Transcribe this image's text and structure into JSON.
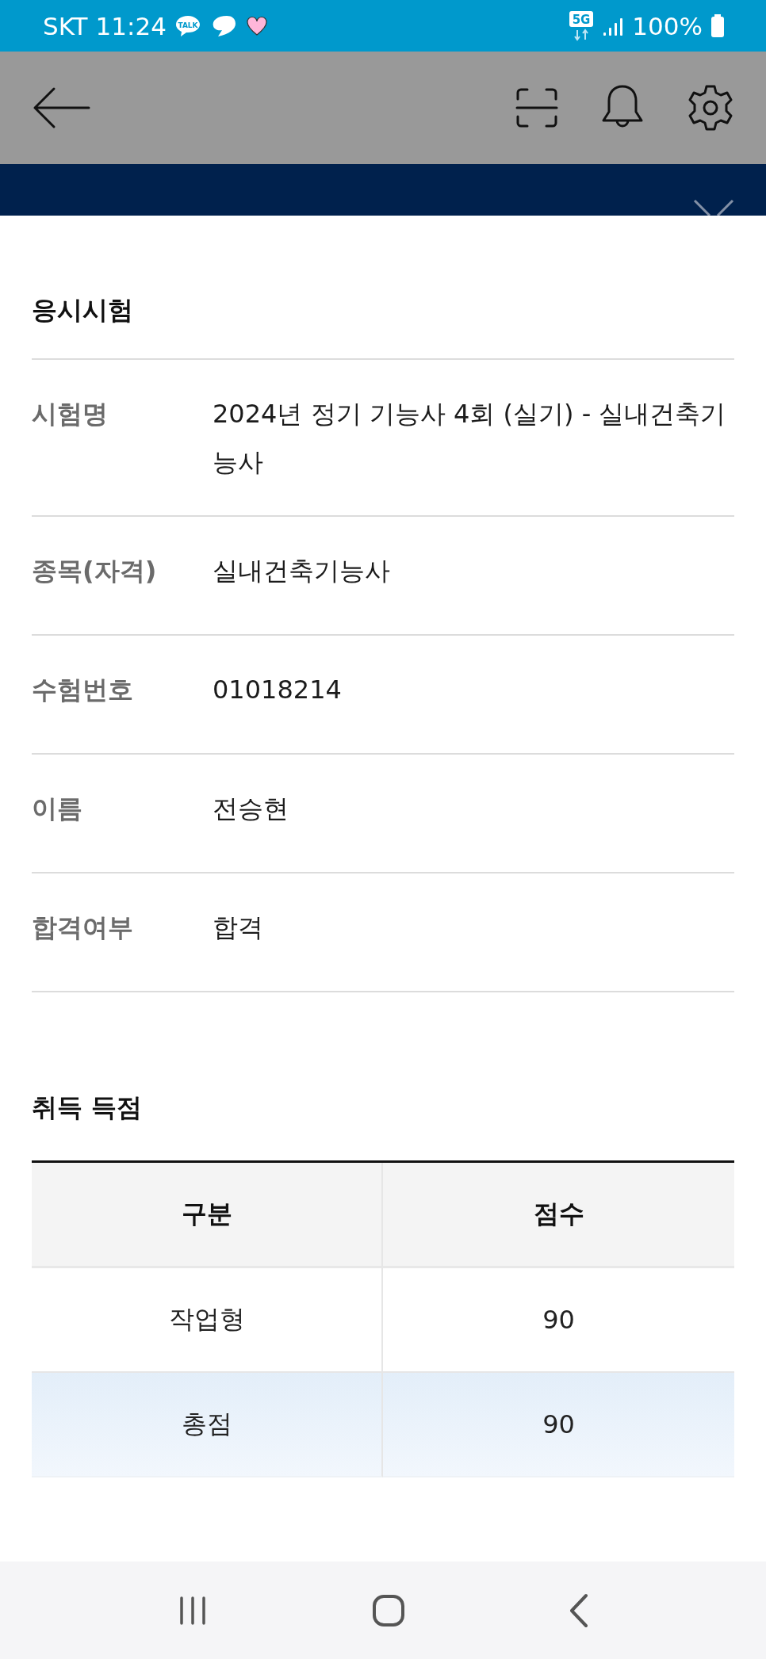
{
  "status_bar": {
    "carrier": "SKT",
    "time": "11:24",
    "talk_badge": "TALK",
    "network": "5G",
    "battery": "100%"
  },
  "exam_section": {
    "title": "응시시험",
    "fields": [
      {
        "label": "시험명",
        "value": "2024년 정기 기능사 4회 (실기) - 실내건축기능사"
      },
      {
        "label": "종목(자격)",
        "value": "실내건축기능사"
      },
      {
        "label": "수험번호",
        "value": "01018214"
      },
      {
        "label": "이름",
        "value": "전승현"
      },
      {
        "label": "합격여부",
        "value": "합격"
      }
    ]
  },
  "score_section": {
    "title": "취득 득점",
    "table": {
      "columns": [
        "구분",
        "점수"
      ],
      "rows": [
        {
          "kind": "item",
          "cells": [
            "작업형",
            "90"
          ]
        },
        {
          "kind": "total",
          "cells": [
            "총점",
            "90"
          ]
        }
      ]
    }
  }
}
